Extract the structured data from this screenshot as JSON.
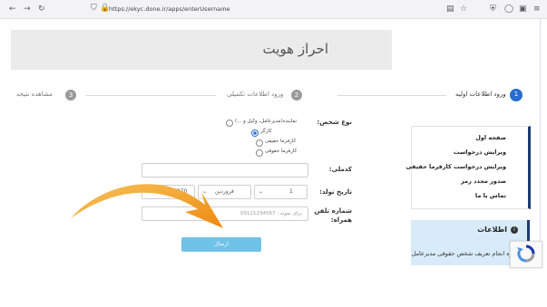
{
  "browser": {
    "url": "https://ekyc.done.ir/apps/enterUsername"
  },
  "page": {
    "title": "احراز هویت"
  },
  "steps": [
    {
      "number": "1",
      "label": "ورود اطلاعات اولیه",
      "active": true
    },
    {
      "number": "2",
      "label": "ورود اطلاعات تکمیلی",
      "active": false
    },
    {
      "number": "3",
      "label": "مشاهده نتیجه",
      "active": false
    }
  ],
  "form": {
    "person_type_label": "نوع شخص:",
    "person_type_options": [
      {
        "label": "نماینده(مدیرعامل، وکیل و ...)",
        "selected": false
      },
      {
        "label": "کارگر",
        "selected": true
      },
      {
        "label": "کارفرما حقیقی",
        "selected": false
      },
      {
        "label": "کارفرما حقوقی",
        "selected": false
      }
    ],
    "national_code_label": "کدملی:",
    "national_code_value": "",
    "birth_date_label": "تاریخ تولد:",
    "birth_day": "1",
    "birth_month": "فروردین",
    "birth_year": "1370",
    "mobile_label_line1": "شماره تلفن",
    "mobile_label_line2": "همراه:",
    "mobile_placeholder": "برای نمونه : 09121234567",
    "submit_label": "ارسال"
  },
  "sidebar": {
    "items": [
      "صفحه اول",
      "ویرایش درخواست",
      "ویرایش درخواست کارفرما حقیقی",
      "صدور مجدد رمز",
      "تماس با ما"
    ]
  },
  "info": {
    "title": "اطلاعات",
    "text": "نحوه انجام تعریف شخص حقوقی مدیرعامل"
  },
  "colors": {
    "accent": "#2a6dd0",
    "submit": "#6fc2e8",
    "sidebar_border": "#1e3a6e",
    "arrow": "#f2a11c"
  }
}
